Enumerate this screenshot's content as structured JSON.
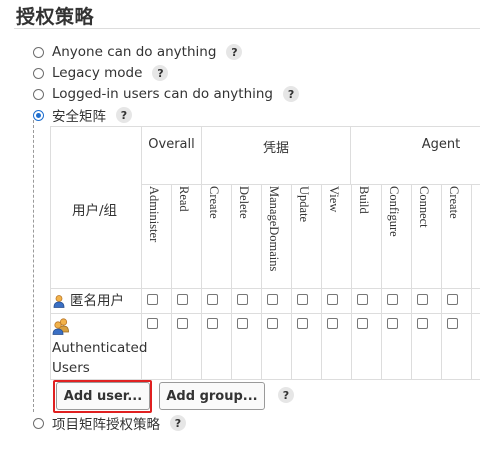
{
  "section_title": "授权策略",
  "options": [
    {
      "label": "Anyone can do anything",
      "help": "?"
    },
    {
      "label": "Legacy mode",
      "help": "?"
    },
    {
      "label": "Logged-in users can do anything",
      "help": "?"
    },
    {
      "label": "安全矩阵",
      "help": "?",
      "selected": true
    },
    {
      "label": "项目矩阵授权策略",
      "help": "?"
    }
  ],
  "matrix": {
    "user_group_header": "用户/组",
    "groups": [
      "Overall",
      "凭据",
      "Agent"
    ],
    "permissions": [
      "Administer",
      "Read",
      "Create",
      "Delete",
      "ManageDomains",
      "Update",
      "View",
      "Build",
      "Configure",
      "Connect",
      "Create"
    ],
    "rows": [
      {
        "name": "匿名用户",
        "icon": "user-icon"
      },
      {
        "name_line1": "Authenticated",
        "name_line2": "Users",
        "icon": "users-group-icon"
      }
    ]
  },
  "buttons": {
    "add_user": "Add user...",
    "add_group": "Add group...",
    "help": "?"
  },
  "colors": {
    "radio_selected": "#1f6fcf",
    "highlight_frame": "#e02020"
  }
}
